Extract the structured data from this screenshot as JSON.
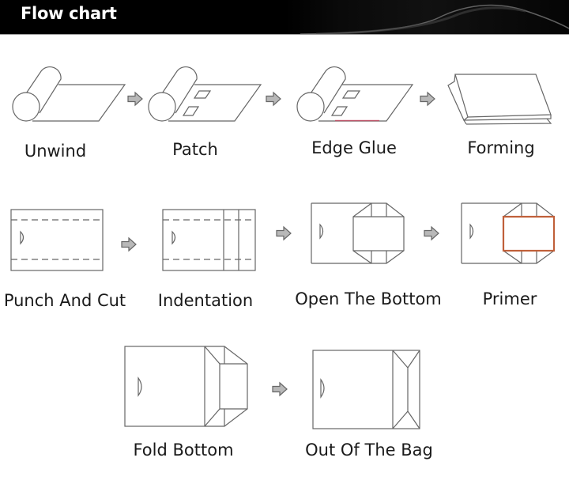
{
  "header": {
    "title": "Flow chart"
  },
  "steps": [
    {
      "label": "Unwind",
      "icon": "roll-icon"
    },
    {
      "label": "Patch",
      "icon": "roll-patch-icon"
    },
    {
      "label": "Edge Glue",
      "icon": "roll-glue-icon"
    },
    {
      "label": "Forming",
      "icon": "tube-forming-icon"
    },
    {
      "label": "Punch And Cut",
      "icon": "punch-cut-icon"
    },
    {
      "label": "Indentation",
      "icon": "indentation-icon"
    },
    {
      "label": "Open The Bottom",
      "icon": "open-bottom-icon"
    },
    {
      "label": "Primer",
      "icon": "primer-icon"
    },
    {
      "label": "Fold Bottom",
      "icon": "fold-bottom-icon"
    },
    {
      "label": "Out Of The Bag",
      "icon": "finished-bag-icon"
    }
  ],
  "colors": {
    "line": "#666666",
    "arrow": "#b5b5b5",
    "glue": "#c8324f",
    "primer": "#c0603a"
  }
}
